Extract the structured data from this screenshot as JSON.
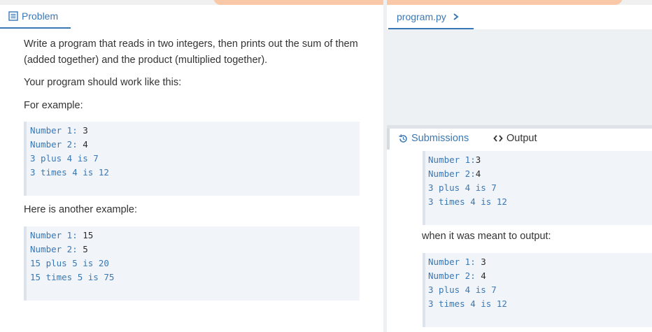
{
  "problem_tab": {
    "label": "Problem"
  },
  "left": {
    "para1": "Write a program that reads in two integers, then prints out the sum of them (added together) and the product (multiplied together).",
    "para2": "Your program should work like this:",
    "para3": "For example:",
    "example1": [
      {
        "key": "Number 1: ",
        "val": "3"
      },
      {
        "key": "Number 2: ",
        "val": "4"
      },
      {
        "out": "3 plus 4 is 7"
      },
      {
        "out": "3 times 4 is 12"
      }
    ],
    "para4": "Here is another example:",
    "example2": [
      {
        "key": "Number 1: ",
        "val": "15"
      },
      {
        "key": "Number 2: ",
        "val": "5"
      },
      {
        "out": "15 plus 5 is 20"
      },
      {
        "out": "15 times 5 is 75"
      }
    ]
  },
  "file_tab": {
    "label": "program.py"
  },
  "bottom_tabs": {
    "submissions": "Submissions",
    "output": "Output"
  },
  "output": {
    "actual": [
      {
        "key": "Number 1:",
        "val": "3"
      },
      {
        "key": "Number 2:",
        "val": "4"
      },
      {
        "out": "3 plus 4 is 7"
      },
      {
        "out": "3 times 4 is 12"
      }
    ],
    "meant_label": "when it was meant to output:",
    "expected": [
      {
        "key": "Number 1: ",
        "val": "3"
      },
      {
        "key": "Number 2: ",
        "val": "4"
      },
      {
        "out": "3 plus 4 is 7"
      },
      {
        "out": "3 times 4 is 12"
      }
    ]
  },
  "colors": {
    "accent": "#3a78b5",
    "code_bg": "#f1f4f8",
    "text": "#333333"
  }
}
